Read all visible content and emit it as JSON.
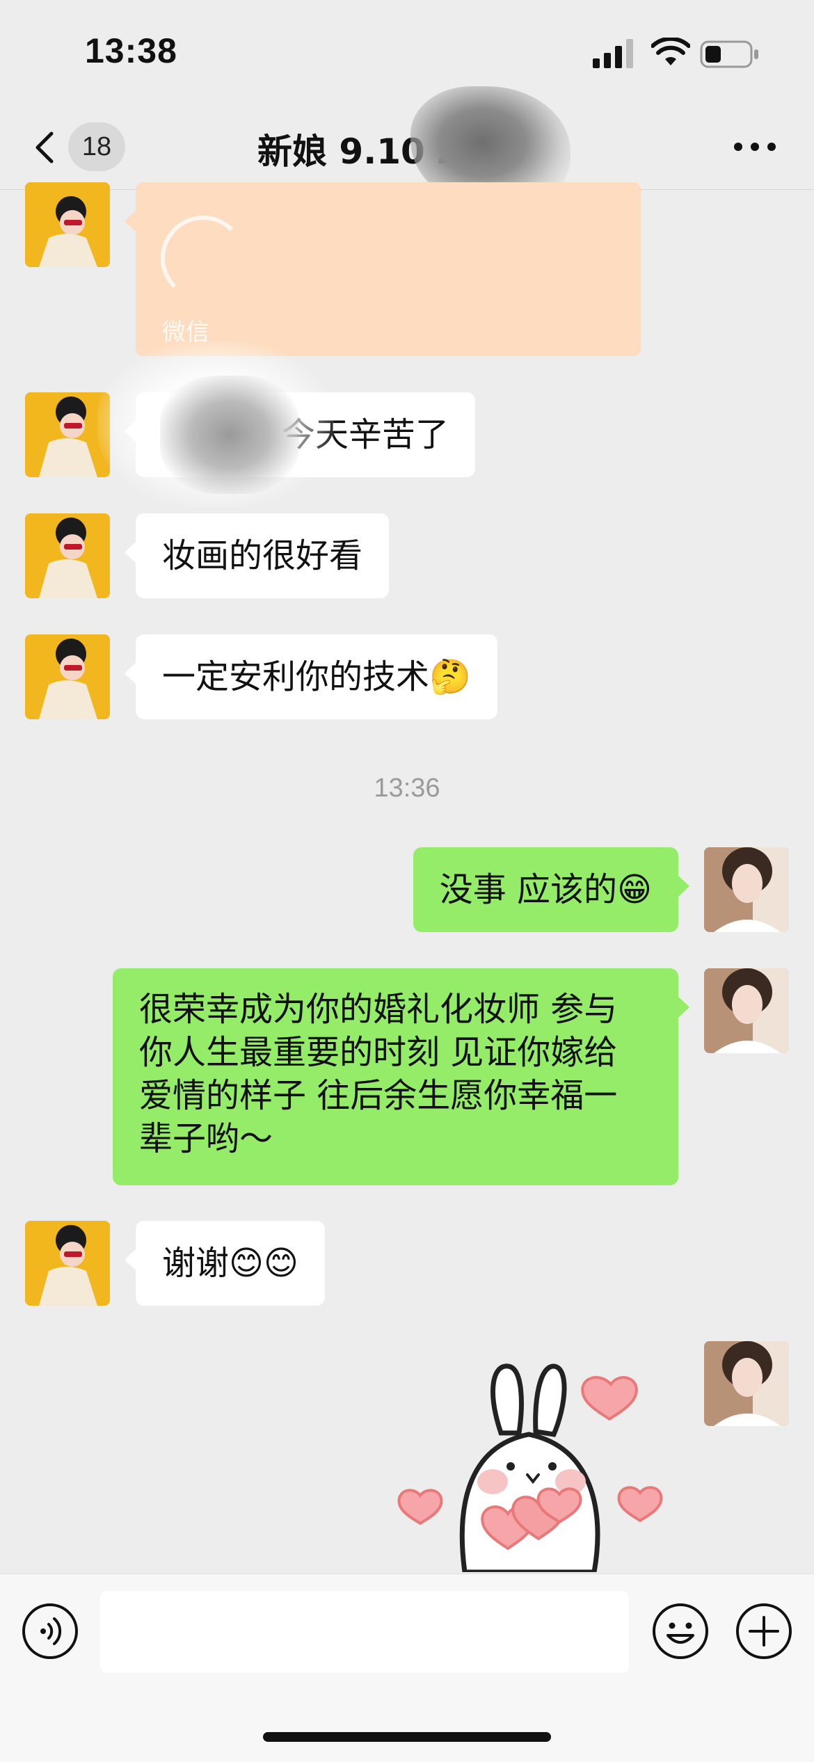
{
  "status_bar": {
    "time": "13:38"
  },
  "nav": {
    "unread_count": "18",
    "title": "新娘 9.10 Z"
  },
  "messages": [
    {
      "side": "in",
      "kind": "card",
      "caption": "微信"
    },
    {
      "side": "in",
      "kind": "text",
      "text": "今天辛苦了"
    },
    {
      "side": "in",
      "kind": "text",
      "text": "妆画的很好看"
    },
    {
      "side": "in",
      "kind": "text",
      "text": "一定安利你的技术🤔"
    },
    {
      "side": "out",
      "kind": "text",
      "text": "没事 应该的😁"
    },
    {
      "side": "out",
      "kind": "text",
      "lines": [
        "很荣幸成为你的婚礼化妆师 参与",
        "你人生最重要的时刻 见证你嫁给",
        "爱情的样子 往后余生愿你幸福一",
        "辈子哟～"
      ]
    },
    {
      "side": "in",
      "kind": "text",
      "text": "谢谢😊😊"
    },
    {
      "side": "out",
      "kind": "sticker",
      "sticker": "bunny-hearts-sticker"
    }
  ],
  "timestamp": "13:36",
  "input": {
    "value": "",
    "placeholder": ""
  },
  "icons": {
    "back": "chevron-left-icon",
    "more": "more-dots-icon",
    "voice": "voice-icon",
    "emoji": "emoji-icon",
    "plus": "plus-icon"
  },
  "colors": {
    "background": "#ededed",
    "outgoing_bubble": "#95ec69",
    "incoming_bubble": "#ffffff",
    "card_bubble": "#fddcbf",
    "avatar_yellow": "#f2b61f"
  }
}
